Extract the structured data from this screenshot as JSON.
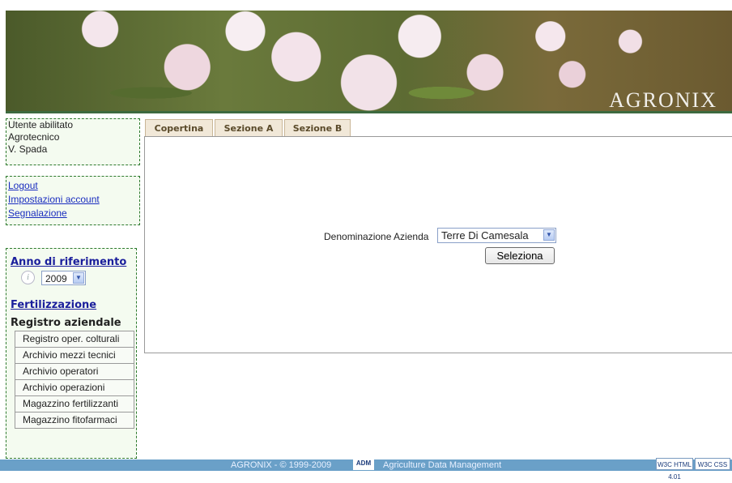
{
  "brand": "AGRONIX",
  "user": {
    "line1": "Utente abilitato",
    "line2": "Agrotecnico",
    "line3": "V. Spada"
  },
  "links": {
    "logout": "Logout",
    "account": "Impostazioni account",
    "report": "Segnalazione"
  },
  "nav": {
    "anno_title": "Anno di riferimento",
    "info_glyph": "i",
    "year_value": "2009",
    "fertilizzazione": "Fertilizzazione",
    "registro_title": "Registro aziendale",
    "registro_items": [
      "Registro oper. colturali",
      "Archivio mezzi tecnici",
      "Archivio operatori",
      "Archivio operazioni",
      "Magazzino fertilizzanti",
      "Magazzino fitofarmaci"
    ]
  },
  "tabs": [
    "Copertina",
    "Sezione A",
    "Sezione B"
  ],
  "form": {
    "azienda_label": "Denominazione Azienda",
    "azienda_value": "Terre Di Camesala",
    "select_button": "Seleziona"
  },
  "footer": {
    "copyright": "AGRONIX - © 1999-2009",
    "adm_logo": "ADM",
    "tagline": "Agriculture Data Management",
    "w3c_html": "W3C HTML 4.01",
    "w3c_css": "W3C CSS"
  },
  "colors": {
    "box_border": "#2d7a2d",
    "link": "#1a2dbf",
    "footer_bg": "#6aa0c8",
    "tab_bg": "#f1e8d8"
  }
}
